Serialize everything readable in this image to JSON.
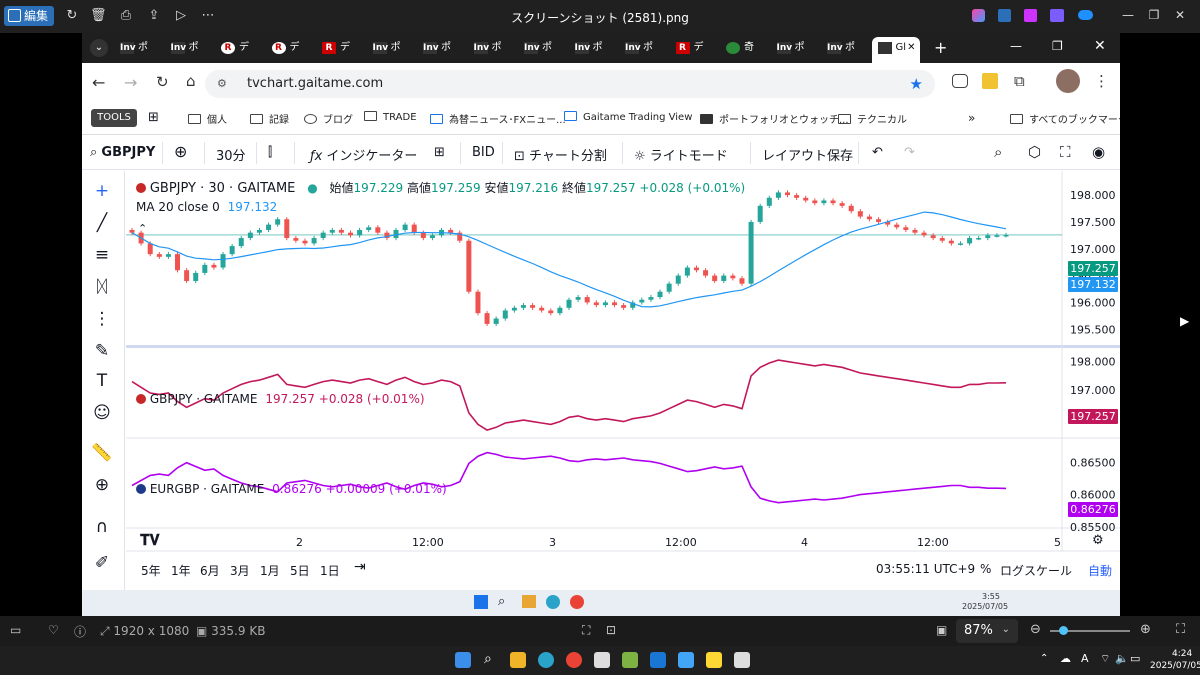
{
  "viewer": {
    "edit_label": "編集",
    "title": "スクリーンショット (2581).png"
  },
  "tabs": [
    {
      "icon": "Inv",
      "label": "ポ"
    },
    {
      "icon": "Inv",
      "label": "ポ"
    },
    {
      "icon": "R",
      "label": "デ"
    },
    {
      "icon": "R",
      "label": "デ"
    },
    {
      "icon": "R",
      "label": "デ"
    },
    {
      "icon": "Inv",
      "label": "ポ"
    },
    {
      "icon": "Inv",
      "label": "ポ"
    },
    {
      "icon": "Inv",
      "label": "ポ"
    },
    {
      "icon": "Inv",
      "label": "ポ"
    },
    {
      "icon": "Inv",
      "label": "ポ"
    },
    {
      "icon": "Inv",
      "label": "ポ"
    },
    {
      "icon": "R",
      "label": "デ"
    },
    {
      "icon": "",
      "label": "奇"
    },
    {
      "icon": "Inv",
      "label": "ポ"
    },
    {
      "icon": "Inv",
      "label": "ポ"
    },
    {
      "icon": "",
      "label": "Gl"
    }
  ],
  "address": {
    "url": "tvchart.gaitame.com"
  },
  "bookmarks": {
    "tools": "TOOLS",
    "items": [
      "個人",
      "記録",
      "ブログ",
      "TRADE",
      "為替ニュース･FXニュー...",
      "Gaitame Trading View",
      "ポートフォリオとウォッチ...",
      "テクニカル"
    ],
    "all": "すべてのブックマーク"
  },
  "tv_toolbar": {
    "symbol": "GBPJPY",
    "interval": "30分",
    "indicators": "インジケーター",
    "bid": "BID",
    "split": "チャート分割",
    "theme": "ライトモード",
    "save": "レイアウト保存"
  },
  "main_pane": {
    "title": "GBPJPY · 30 · GAITAME",
    "o_label": "始値",
    "o": "197.229",
    "h_label": "高値",
    "h": "197.259",
    "l_label": "安値",
    "l": "197.216",
    "c_label": "終値",
    "c": "197.257",
    "chg": "+0.028 (+0.01%)",
    "ma_label": "MA 20 close 0",
    "ma": "197.132",
    "last_tag": "197.257",
    "ma_tag": "197.132"
  },
  "pane2": {
    "title": "GBPJPY · GAITAME",
    "value": "197.257",
    "chg": "+0.028 (+0.01%)",
    "tag": "197.257"
  },
  "pane3": {
    "title": "EURGBP · GAITAME",
    "value": "0.86276",
    "chg": "+0.00009 (+0.01%)",
    "tag": "0.86276"
  },
  "x_axis": [
    "2",
    "12:00",
    "3",
    "12:00",
    "4",
    "12:00",
    "5"
  ],
  "bottom_bar": {
    "ranges": [
      "5年",
      "1年",
      "6月",
      "3月",
      "1月",
      "5日",
      "1日"
    ],
    "time": "03:55:11 UTC+9",
    "pct": "%",
    "log": "ログスケール",
    "auto": "自動"
  },
  "photo_status": {
    "size": "1920 x 1080",
    "filesize": "335.9 KB",
    "zoom": "87%"
  },
  "inner_clock": {
    "time": "3:55",
    "date": "2025/07/05"
  },
  "clock": {
    "time": "4:24",
    "date": "2025/07/05"
  },
  "colors": {
    "up": "#26a69a",
    "down": "#ef5350",
    "ma": "#2196f3",
    "pane2": "#c2185b",
    "pane3": "#b000f0"
  },
  "chart_data": [
    {
      "type": "candlestick",
      "title": "GBPJPY · 30 · GAITAME",
      "ylim": [
        195.3,
        198.3
      ],
      "yticks": [
        195.5,
        196.0,
        196.5,
        197.0,
        197.5,
        198.0
      ],
      "x_ticks": [
        "2",
        "12:00",
        "3",
        "12:00",
        "4",
        "12:00",
        "5"
      ],
      "close": [
        197.3,
        197.1,
        196.9,
        196.85,
        196.9,
        196.6,
        196.4,
        196.55,
        196.7,
        196.65,
        196.9,
        197.05,
        197.2,
        197.3,
        197.35,
        197.45,
        197.55,
        197.2,
        197.15,
        197.1,
        197.2,
        197.3,
        197.35,
        197.3,
        197.25,
        197.35,
        197.4,
        197.3,
        197.2,
        197.35,
        197.45,
        197.3,
        197.2,
        197.25,
        197.35,
        197.3,
        197.15,
        196.2,
        195.8,
        195.6,
        195.7,
        195.85,
        195.9,
        195.95,
        195.9,
        195.85,
        195.8,
        195.9,
        196.05,
        196.1,
        196.0,
        195.95,
        196.0,
        195.95,
        195.9,
        196.0,
        196.05,
        196.1,
        196.2,
        196.35,
        196.5,
        196.65,
        196.6,
        196.5,
        196.4,
        196.5,
        196.45,
        196.35,
        197.5,
        197.8,
        197.95,
        198.05,
        198.0,
        197.95,
        197.9,
        197.85,
        197.9,
        197.85,
        197.8,
        197.7,
        197.6,
        197.55,
        197.5,
        197.45,
        197.4,
        197.35,
        197.3,
        197.25,
        197.2,
        197.15,
        197.1,
        197.1,
        197.2,
        197.2,
        197.25,
        197.25,
        197.257
      ],
      "series": [
        {
          "name": "MA 20 close 0",
          "last": 197.132
        }
      ]
    },
    {
      "type": "line",
      "title": "GBPJPY · GAITAME",
      "ylim": [
        195.5,
        198.3
      ],
      "yticks": [
        196.0,
        197.0,
        198.0
      ],
      "last": 197.257
    },
    {
      "type": "line",
      "title": "EURGBP · GAITAME",
      "ylim": [
        0.855,
        0.868
      ],
      "yticks": [
        0.855,
        0.86,
        0.865
      ],
      "last": 0.86276
    }
  ]
}
